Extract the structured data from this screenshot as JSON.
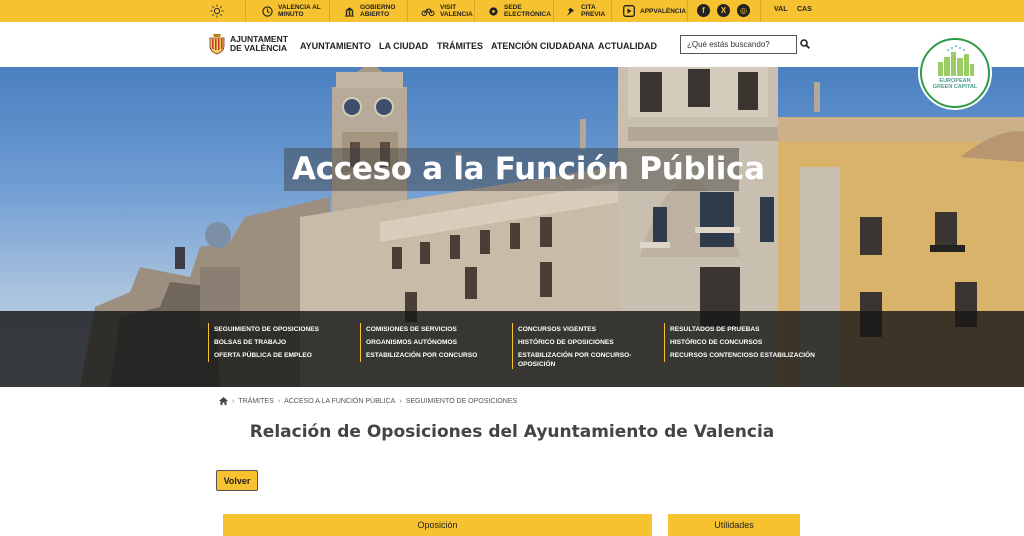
{
  "topbar": {
    "links": [
      {
        "label_1": "VALENCIA AL",
        "label_2": "MINUTO",
        "icon": "clock-icon"
      },
      {
        "label_1": "GOBIERNO",
        "label_2": "ABIERTO",
        "icon": "building-icon"
      },
      {
        "label_1": "VISIT",
        "label_2": "VALENCIA",
        "icon": "bike-icon"
      },
      {
        "label_1": "SEDE",
        "label_2": "ELECTRÓNICA",
        "icon": "pin-icon"
      },
      {
        "label_1": "CITA",
        "label_2": "PREVIA",
        "icon": "hand-icon"
      },
      {
        "label_1": "APPVALÈNCIA",
        "label_2": "",
        "icon": "app-icon"
      }
    ],
    "social": [
      {
        "glyph": "f",
        "icon": "facebook-icon"
      },
      {
        "glyph": "X",
        "icon": "x-icon"
      },
      {
        "glyph": "◎",
        "icon": "instagram-icon"
      }
    ],
    "languages": [
      "VAL",
      "CAS"
    ]
  },
  "header": {
    "logo_line1": "AJUNTAMENT",
    "logo_line2": "DE VALÈNCIA",
    "nav": [
      "AYUNTAMIENTO",
      "LA CIUDAD",
      "TRÁMITES",
      "ATENCIÓN CIUDADANA",
      "ACTUALIDAD"
    ],
    "search_placeholder": "¿Qué estás buscando?"
  },
  "badge": {
    "line1": "EUROPEAN",
    "line2": "GREEN CAPITAL"
  },
  "hero": {
    "title": "Acceso a la Función Pública"
  },
  "menu": {
    "columns": [
      [
        "SEGUIMIENTO DE OPOSICIONES",
        "BOLSAS DE TRABAJO",
        "OFERTA PÚBLICA DE EMPLEO"
      ],
      [
        "COMISIONES DE SERVICIOS",
        "ORGANISMOS AUTÓNOMOS",
        "ESTABILIZACIÓN POR CONCURSO"
      ],
      [
        "CONCURSOS VIGENTES",
        "HISTÓRICO DE OPOSICIONES",
        "ESTABILIZACIÓN POR CONCURSO-",
        "OPOSICIÓN"
      ],
      [
        "RESULTADOS DE PRUEBAS",
        "HISTÓRICO DE CONCURSOS",
        "RECURSOS CONTENCIOSO ESTABILIZACIÓN"
      ]
    ]
  },
  "breadcrumb": [
    "TRÁMITES",
    "ACCESO A LA FUNCIÓN PÚBLICA",
    "SEGUIMIENTO DE OPOSICIONES"
  ],
  "main": {
    "title": "Relación de Oposiciones del Ayuntamiento de Valencia",
    "back_label": "Volver",
    "table_headers": [
      "Oposición",
      "Utilidades"
    ]
  },
  "colors": {
    "accent": "#f7c230",
    "dark_overlay": "#191919"
  }
}
